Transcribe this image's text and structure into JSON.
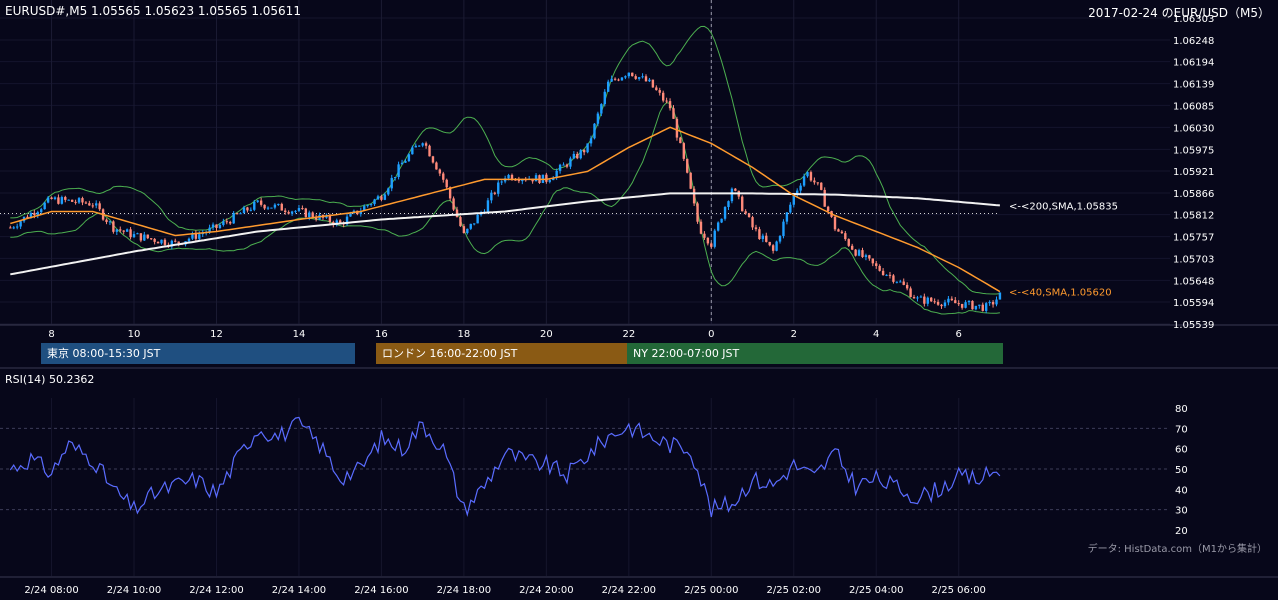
{
  "header": {
    "symbol_line": "EURUSD#,M5 1.05565 1.05623 1.05565 1.05611",
    "title": "2017-02-24 のEUR/USD（M5）"
  },
  "colors": {
    "background": "#07071a",
    "bull_candle": "#1e9fff",
    "bear_candle": "#ff8a7a",
    "sma40": "#ff9a2e",
    "sma200": "#f2f2f2",
    "bollinger": "#4caf50",
    "rsi": "#5a6cff",
    "tokyo": "#1f4f80",
    "london": "#8a5a14",
    "ny": "#236838"
  },
  "sessions": [
    {
      "label": "東京 08:00-15:30 JST",
      "color": "#1f4f80"
    },
    {
      "label": "ロンドン 16:00-22:00 JST",
      "color": "#8a5a14"
    },
    {
      "label": "NY 22:00-07:00 JST",
      "color": "#236838"
    }
  ],
  "rsi": {
    "label": "RSI(14) 50.2362"
  },
  "source_note": "データ: HistData.com（M1から集計）",
  "chart_data": [
    {
      "type": "candlestick",
      "title": "2017-02-24 のEUR/USD（M5）",
      "x_tick_labels": [
        "8",
        "10",
        "12",
        "14",
        "16",
        "18",
        "20",
        "22",
        "0",
        "2",
        "4",
        "6"
      ],
      "y_tick_labels": [
        "1.06303",
        "1.06248",
        "1.06194",
        "1.06139",
        "1.06085",
        "1.06030",
        "1.05975",
        "1.05921",
        "1.05866",
        "1.05812",
        "1.05757",
        "1.05703",
        "1.05648",
        "1.05594",
        "1.05539"
      ],
      "ylim": [
        1.05539,
        1.06303
      ],
      "annotations": [
        {
          "text": "<-<200,SMA,1.05835",
          "series": "SMA200"
        },
        {
          "text": "<-<40,SMA,1.05620",
          "series": "SMA40"
        }
      ],
      "keypoints": {
        "x_hours": [
          7,
          8,
          9,
          9.5,
          10,
          11,
          12,
          13,
          14,
          15,
          16,
          16.5,
          17,
          17.5,
          18,
          18.5,
          19,
          20,
          21,
          21.5,
          22,
          22.5,
          23,
          23.3,
          23.7,
          24,
          24.5,
          25,
          25.5,
          26,
          26.3,
          26.6,
          27,
          27.5,
          28,
          28.5,
          29,
          30,
          30.7,
          31
        ],
        "close": [
          1.0578,
          1.0585,
          1.0584,
          1.0578,
          1.0576,
          1.0574,
          1.0578,
          1.0584,
          1.0582,
          1.0579,
          1.0586,
          1.0594,
          1.06,
          1.059,
          1.0576,
          1.0583,
          1.0591,
          1.059,
          1.0598,
          1.0614,
          1.0617,
          1.0614,
          1.0608,
          1.0596,
          1.0578,
          1.0574,
          1.0588,
          1.0578,
          1.0572,
          1.0586,
          1.0592,
          1.0588,
          1.0578,
          1.0572,
          1.0568,
          1.0565,
          1.056,
          1.0559,
          1.0558,
          1.0561
        ]
      },
      "sma40_keypoints": {
        "x_hours": [
          7,
          8,
          9,
          10,
          11,
          12,
          14,
          15.5,
          17,
          18.5,
          20,
          21,
          22,
          23,
          24,
          25,
          26,
          27,
          28,
          29,
          30,
          31
        ],
        "values": [
          1.0579,
          1.0582,
          1.0582,
          1.0579,
          1.0576,
          1.0577,
          1.058,
          1.0582,
          1.0586,
          1.059,
          1.059,
          1.0592,
          1.0598,
          1.0603,
          1.0599,
          1.0593,
          1.0586,
          1.0581,
          1.0577,
          1.0573,
          1.0568,
          1.0562
        ]
      },
      "sma200_keypoints": {
        "x_hours": [
          7,
          10,
          13,
          16,
          19,
          21,
          23,
          25,
          27,
          29,
          31
        ],
        "values": [
          1.05663,
          1.0572,
          1.0577,
          1.058,
          1.0582,
          1.05845,
          1.05865,
          1.05865,
          1.05862,
          1.05853,
          1.05835
        ]
      },
      "reference_line": 1.05815
    },
    {
      "type": "line",
      "title": "RSI(14) 50.2362",
      "x_tick_labels": [
        "2/24 08:00",
        "2/24 10:00",
        "2/24 12:00",
        "2/24 14:00",
        "2/24 16:00",
        "2/24 18:00",
        "2/24 20:00",
        "2/24 22:00",
        "2/25 00:00",
        "2/25 02:00",
        "2/25 04:00",
        "2/25 06:00"
      ],
      "y_tick_labels": [
        "80",
        "70",
        "60",
        "50",
        "40",
        "30",
        "20"
      ],
      "ylim": [
        20,
        80
      ],
      "gridlines": [
        70,
        50,
        30
      ],
      "series": [
        {
          "name": "RSI(14)",
          "keypoints": {
            "x_hours": [
              7,
              7.5,
              8,
              8.4,
              9,
              9.5,
              10,
              10.5,
              11,
              11.5,
              12,
              12.5,
              13,
              13.5,
              14,
              14.5,
              15,
              15.5,
              16,
              16.5,
              17,
              17.5,
              18,
              18.5,
              19,
              19.5,
              20,
              20.5,
              21,
              21.5,
              22,
              22.5,
              23,
              23.5,
              24,
              24.5,
              25,
              25.5,
              26,
              26.5,
              27,
              27.5,
              28,
              28.5,
              29,
              29.5,
              30,
              30.5,
              31
            ],
            "values": [
              50,
              55,
              48,
              62,
              55,
              40,
              30,
              38,
              42,
              45,
              38,
              55,
              70,
              66,
              72,
              62,
              46,
              50,
              65,
              60,
              72,
              60,
              30,
              42,
              58,
              54,
              52,
              47,
              57,
              66,
              71,
              66,
              62,
              60,
              30,
              33,
              45,
              42,
              52,
              46,
              58,
              42,
              45,
              41,
              36,
              40,
              46,
              45,
              50
            ]
          }
        }
      ]
    }
  ]
}
